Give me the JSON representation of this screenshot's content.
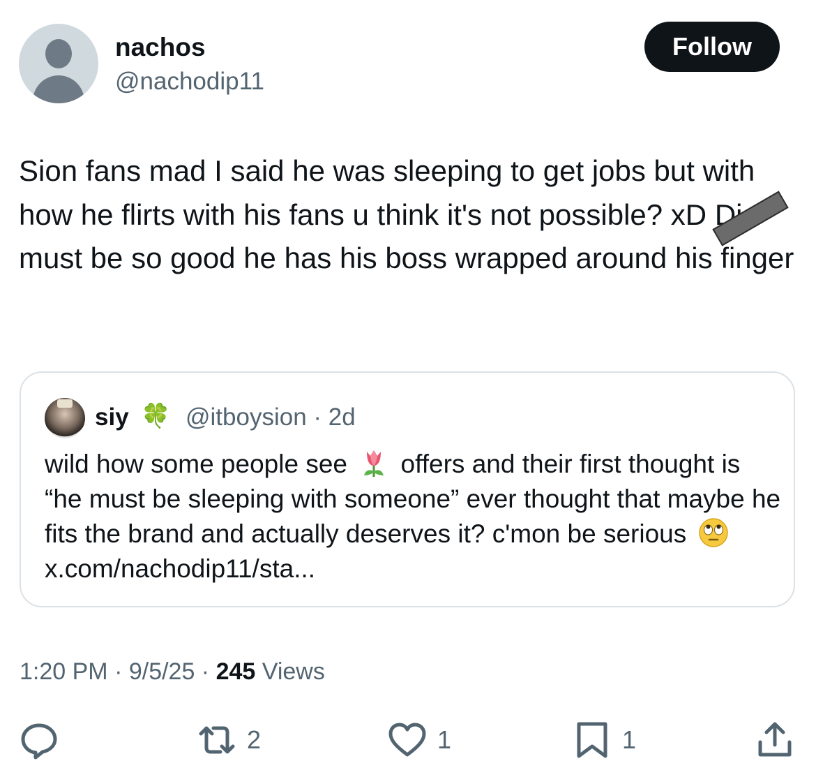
{
  "author": {
    "display_name": "nachos",
    "handle": "@nachodip11"
  },
  "follow_button": {
    "label": "Follow"
  },
  "tweet": {
    "text_before_redaction": "Sion fans mad I said he was sleeping to get jobs but with how he flirts with his fans u think it's not possible? xD ",
    "redacted_word_visible": "Di",
    "text_after_redaction": "must be so good he has his boss wrapped around his finger"
  },
  "quoted_tweet": {
    "display_name": "siy",
    "name_emoji": "🍀",
    "meta": "@itboysion · 2d",
    "text_part1": "wild how some people see",
    "emoji1": "tulip-emoji",
    "text_part2": "offers and their first thought is “he must be sleeping with someone” ever thought that maybe he fits the brand and actually deserves it? c'mon be serious",
    "emoji2": "eye-roll-emoji",
    "link": "x.com/nachodip11/sta..."
  },
  "timestamp": {
    "time_date": "1:20 PM · 9/5/25 · ",
    "views_count": "245",
    "views_label": "Views"
  },
  "actions": {
    "reply_count": "",
    "repost_count": "2",
    "like_count": "1",
    "bookmark_count": "1"
  },
  "colors": {
    "text": "#0f1419",
    "secondary": "#536471",
    "border": "#dbe1e6",
    "button_bg": "#0f1419"
  }
}
